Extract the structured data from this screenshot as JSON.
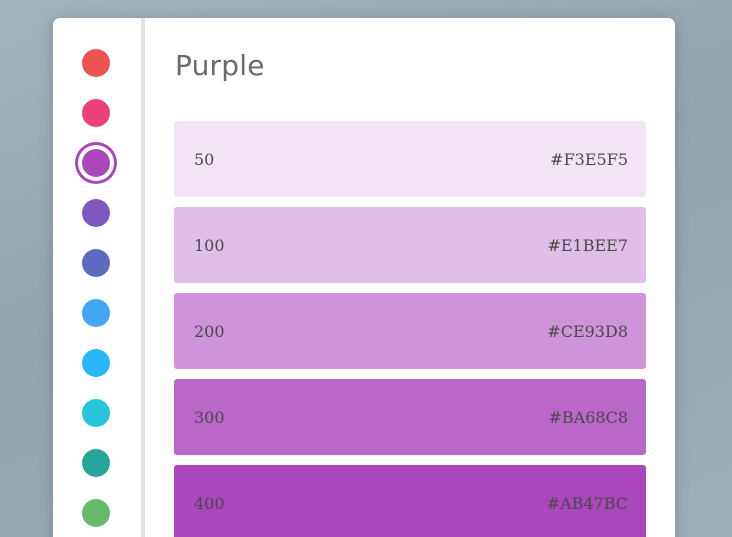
{
  "palette": {
    "title": "Purple",
    "colors": [
      {
        "name": "red",
        "hex": "#EF5350"
      },
      {
        "name": "pink",
        "hex": "#EC407A"
      },
      {
        "name": "purple",
        "hex": "#AB47BC",
        "selected": true
      },
      {
        "name": "deep-purple",
        "hex": "#7E57C2"
      },
      {
        "name": "indigo",
        "hex": "#5C6BC0"
      },
      {
        "name": "blue",
        "hex": "#42A5F5"
      },
      {
        "name": "light-blue",
        "hex": "#29B6F6"
      },
      {
        "name": "cyan",
        "hex": "#26C6DA"
      },
      {
        "name": "teal",
        "hex": "#26A69A"
      },
      {
        "name": "green",
        "hex": "#66BB6A"
      }
    ],
    "selected_ring_color": "#AB47BC"
  },
  "shades": [
    {
      "label": "50",
      "hex": "#F3E5F5"
    },
    {
      "label": "100",
      "hex": "#E1BEE7"
    },
    {
      "label": "200",
      "hex": "#CE93D8"
    },
    {
      "label": "300",
      "hex": "#BA68C8"
    },
    {
      "label": "400",
      "hex": "#AB47BC"
    }
  ]
}
